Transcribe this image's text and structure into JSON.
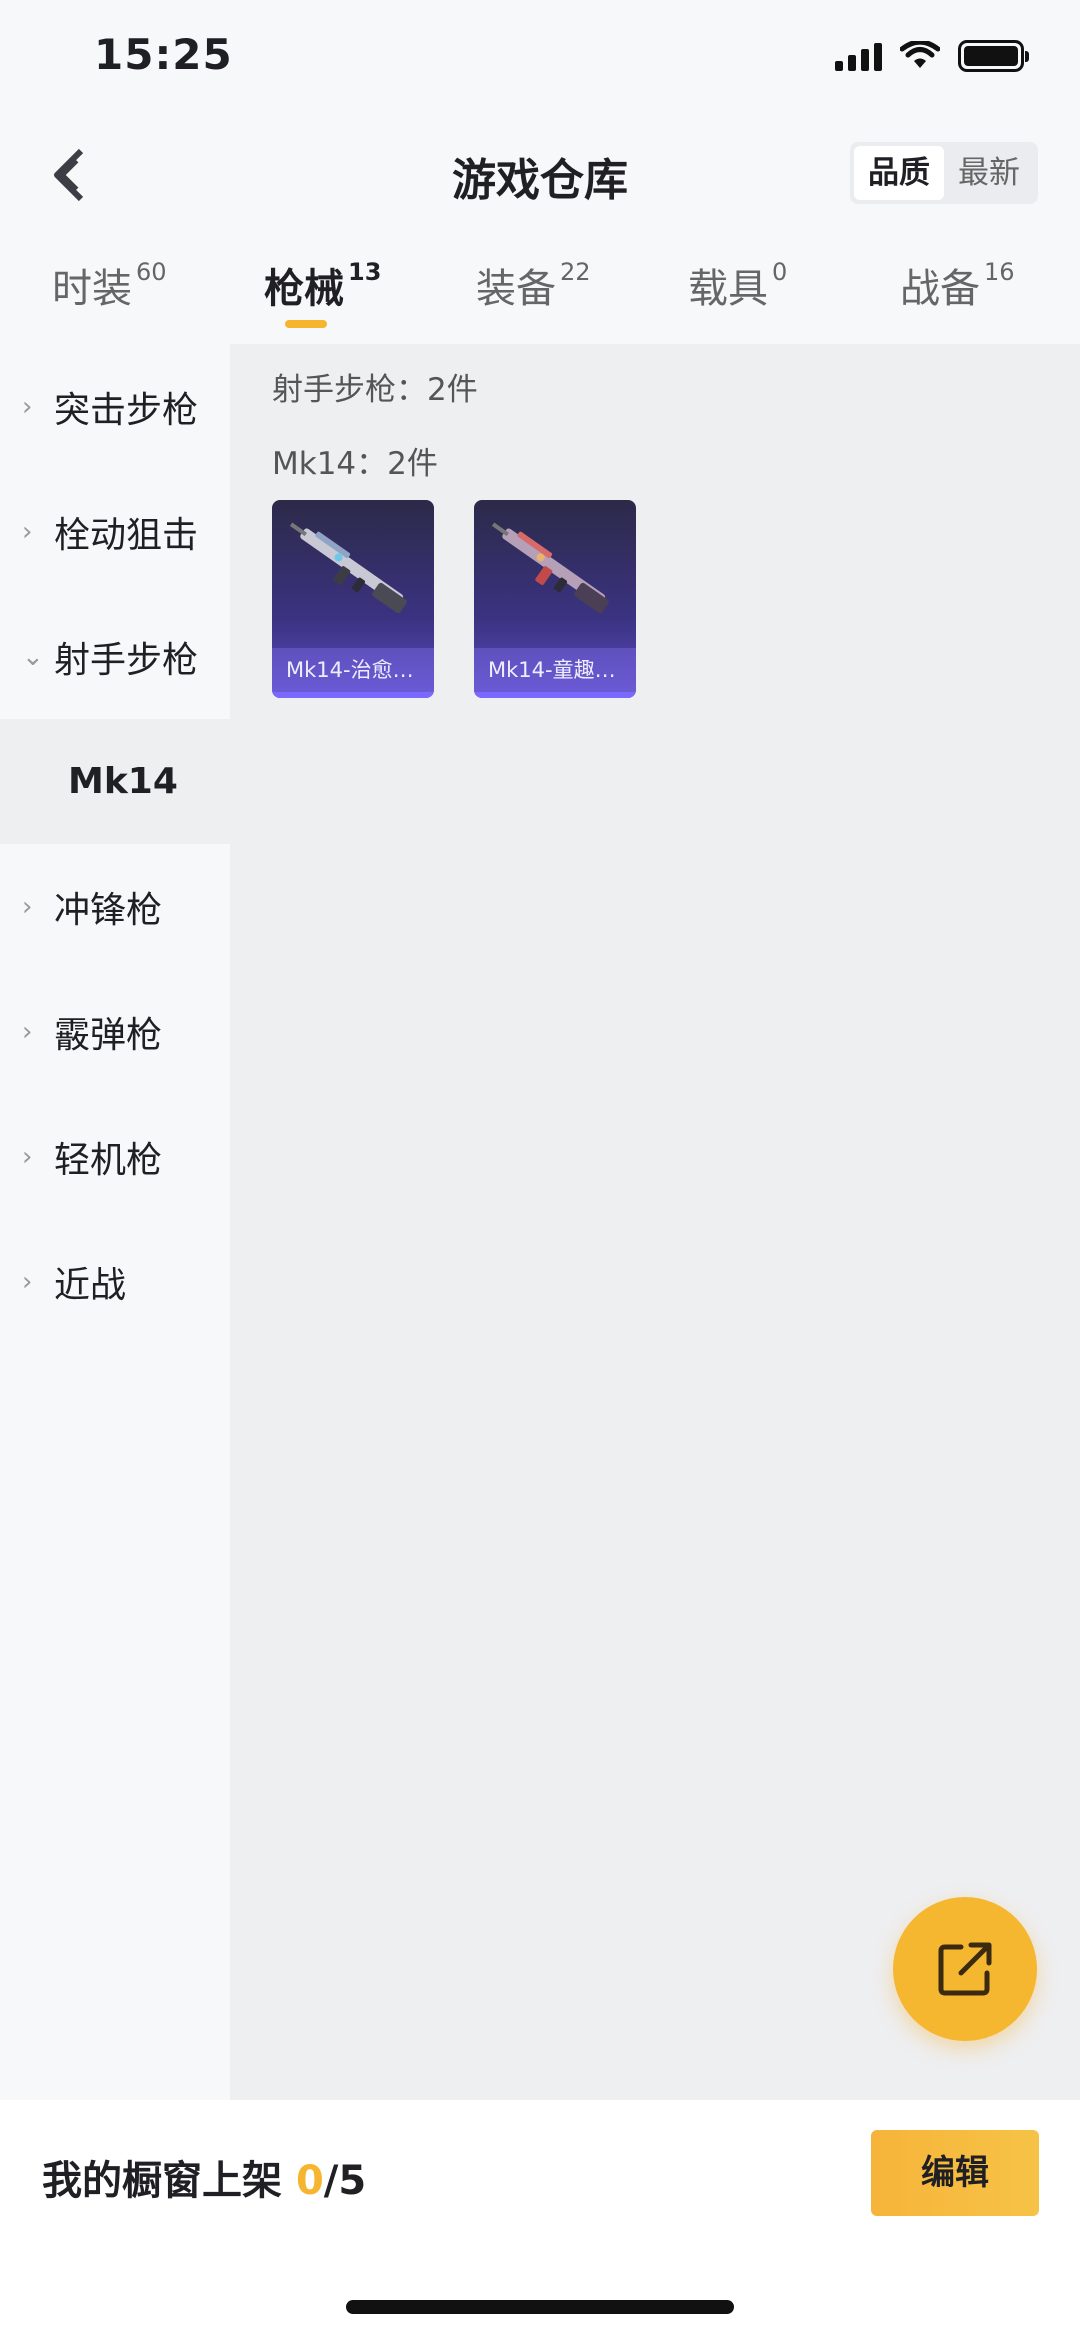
{
  "status_bar": {
    "time": "15:25"
  },
  "header": {
    "title": "游戏仓库",
    "sort_options": [
      "品质",
      "最新"
    ],
    "active_sort": "品质"
  },
  "tabs": [
    {
      "label": "时装",
      "count": "60"
    },
    {
      "label": "枪械",
      "count": "13"
    },
    {
      "label": "装备",
      "count": "22"
    },
    {
      "label": "载具",
      "count": "0"
    },
    {
      "label": "战备",
      "count": "16"
    }
  ],
  "active_tab": "枪械",
  "sidebar": {
    "items": [
      {
        "label": "突击步枪",
        "expanded": false
      },
      {
        "label": "栓动狙击",
        "expanded": false
      },
      {
        "label": "射手步枪",
        "expanded": true
      },
      {
        "label": "Mk14",
        "selected": true
      },
      {
        "label": "冲锋枪",
        "expanded": false
      },
      {
        "label": "霰弹枪",
        "expanded": false
      },
      {
        "label": "轻机枪",
        "expanded": false
      },
      {
        "label": "近战",
        "expanded": false
      }
    ]
  },
  "content": {
    "category_summary": "射手步枪：2件",
    "subcategory_summary": "Mk14：2件",
    "items": [
      {
        "name": "Mk14-治愈…"
      },
      {
        "name": "Mk14-童趣…"
      }
    ]
  },
  "bottom_bar": {
    "shelf_label": "我的橱窗上架 ",
    "shelf_count": "0",
    "shelf_total": "/5",
    "edit_label": "编辑"
  },
  "colors": {
    "accent": "#f5b52e",
    "card_purple": "#3b3382"
  },
  "icons": [
    "back-icon",
    "share-icon",
    "chevron-right-icon",
    "chevron-down-icon",
    "wifi-icon",
    "signal-icon",
    "battery-icon"
  ]
}
